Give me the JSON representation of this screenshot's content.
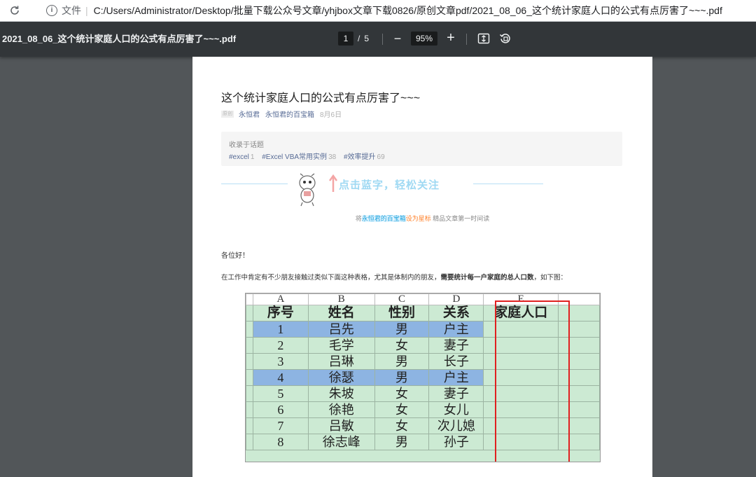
{
  "browser": {
    "scheme_label": "文件",
    "url": "C:/Users/Administrator/Desktop/批量下载公众号文章/yhjbox文章下载0826/原创文章pdf/2021_08_06_这个统计家庭人口的公式有点厉害了~~~.pdf"
  },
  "pdf_toolbar": {
    "title": "2021_08_06_这个统计家庭人口的公式有点厉害了~~~.pdf",
    "current_page": "1",
    "page_sep": "/",
    "total_pages": "5",
    "zoom_out": "−",
    "zoom": "95%",
    "zoom_in": "+"
  },
  "article": {
    "title": "这个统计家庭人口的公式有点厉害了~~~",
    "original_badge": "原创",
    "author": "永恒君",
    "account": "永恒君的百宝箱",
    "date": "8月6日",
    "topics_heading": "收录于话题",
    "topics": [
      {
        "tag": "#excel",
        "count": "1"
      },
      {
        "tag": "#Excel VBA常用实例",
        "count": "38"
      },
      {
        "tag": "#效率提升",
        "count": "69"
      }
    ],
    "follow_text": "点击蓝字，轻松关注",
    "star_prefix": "将",
    "star_account": "永恒君的百宝箱",
    "star_action": "设为星标",
    "star_suffix": " 精品文章第一时间读",
    "greeting": "各位好！",
    "para_normal": "在工作中肯定有不少朋友接触过类似下面这种表格，尤其是体制内的朋友，",
    "para_bold": "需要统计每一户家庭的总人口数",
    "para_end": "，如下图："
  },
  "sheet": {
    "col_letters": [
      "A",
      "B",
      "C",
      "D",
      "E"
    ],
    "headers": [
      "序号",
      "姓名",
      "性别",
      "关系",
      "家庭人口"
    ],
    "rows": [
      {
        "no": "1",
        "name": "吕先",
        "sex": "男",
        "rel": "户主"
      },
      {
        "no": "2",
        "name": "毛学",
        "sex": "女",
        "rel": "妻子"
      },
      {
        "no": "3",
        "name": "吕琳",
        "sex": "男",
        "rel": "长子"
      },
      {
        "no": "4",
        "name": "徐瑟",
        "sex": "男",
        "rel": "户主"
      },
      {
        "no": "5",
        "name": "朱坡",
        "sex": "女",
        "rel": "妻子"
      },
      {
        "no": "6",
        "name": "徐艳",
        "sex": "女",
        "rel": "女儿"
      },
      {
        "no": "7",
        "name": "吕敏",
        "sex": "女",
        "rel": "次儿媳"
      },
      {
        "no": "8",
        "name": "徐志峰",
        "sex": "男",
        "rel": "孙子"
      }
    ],
    "highlight_color": "#8db4e2",
    "fill_color": "#ccead3",
    "box_color": "#e02020"
  }
}
